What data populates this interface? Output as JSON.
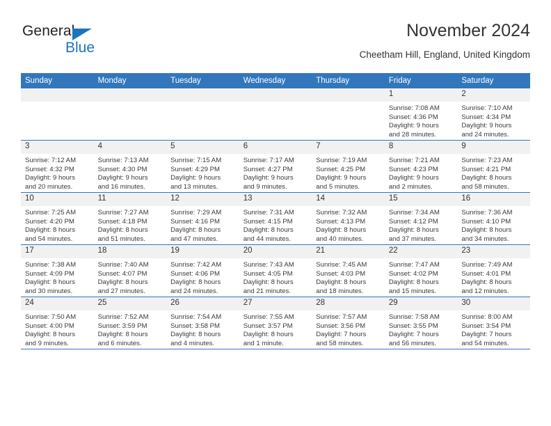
{
  "brand": {
    "name_top": "General",
    "name_bottom": "Blue",
    "triangle_color": "#1b75bc"
  },
  "header": {
    "title": "November 2024",
    "subtitle": "Cheetham Hill, England, United Kingdom"
  },
  "theme": {
    "header_blue": "#3277bc",
    "daynum_gray": "#f1f1f1",
    "text": "#333333"
  },
  "weekdays": [
    "Sunday",
    "Monday",
    "Tuesday",
    "Wednesday",
    "Thursday",
    "Friday",
    "Saturday"
  ],
  "weeks": [
    [
      {
        "day": "",
        "sunrise": "",
        "sunset": "",
        "daylight_line1": "",
        "daylight_line2": ""
      },
      {
        "day": "",
        "sunrise": "",
        "sunset": "",
        "daylight_line1": "",
        "daylight_line2": ""
      },
      {
        "day": "",
        "sunrise": "",
        "sunset": "",
        "daylight_line1": "",
        "daylight_line2": ""
      },
      {
        "day": "",
        "sunrise": "",
        "sunset": "",
        "daylight_line1": "",
        "daylight_line2": ""
      },
      {
        "day": "",
        "sunrise": "",
        "sunset": "",
        "daylight_line1": "",
        "daylight_line2": ""
      },
      {
        "day": "1",
        "sunrise": "Sunrise: 7:08 AM",
        "sunset": "Sunset: 4:36 PM",
        "daylight_line1": "Daylight: 9 hours",
        "daylight_line2": "and 28 minutes."
      },
      {
        "day": "2",
        "sunrise": "Sunrise: 7:10 AM",
        "sunset": "Sunset: 4:34 PM",
        "daylight_line1": "Daylight: 9 hours",
        "daylight_line2": "and 24 minutes."
      }
    ],
    [
      {
        "day": "3",
        "sunrise": "Sunrise: 7:12 AM",
        "sunset": "Sunset: 4:32 PM",
        "daylight_line1": "Daylight: 9 hours",
        "daylight_line2": "and 20 minutes."
      },
      {
        "day": "4",
        "sunrise": "Sunrise: 7:13 AM",
        "sunset": "Sunset: 4:30 PM",
        "daylight_line1": "Daylight: 9 hours",
        "daylight_line2": "and 16 minutes."
      },
      {
        "day": "5",
        "sunrise": "Sunrise: 7:15 AM",
        "sunset": "Sunset: 4:29 PM",
        "daylight_line1": "Daylight: 9 hours",
        "daylight_line2": "and 13 minutes."
      },
      {
        "day": "6",
        "sunrise": "Sunrise: 7:17 AM",
        "sunset": "Sunset: 4:27 PM",
        "daylight_line1": "Daylight: 9 hours",
        "daylight_line2": "and 9 minutes."
      },
      {
        "day": "7",
        "sunrise": "Sunrise: 7:19 AM",
        "sunset": "Sunset: 4:25 PM",
        "daylight_line1": "Daylight: 9 hours",
        "daylight_line2": "and 5 minutes."
      },
      {
        "day": "8",
        "sunrise": "Sunrise: 7:21 AM",
        "sunset": "Sunset: 4:23 PM",
        "daylight_line1": "Daylight: 9 hours",
        "daylight_line2": "and 2 minutes."
      },
      {
        "day": "9",
        "sunrise": "Sunrise: 7:23 AM",
        "sunset": "Sunset: 4:21 PM",
        "daylight_line1": "Daylight: 8 hours",
        "daylight_line2": "and 58 minutes."
      }
    ],
    [
      {
        "day": "10",
        "sunrise": "Sunrise: 7:25 AM",
        "sunset": "Sunset: 4:20 PM",
        "daylight_line1": "Daylight: 8 hours",
        "daylight_line2": "and 54 minutes."
      },
      {
        "day": "11",
        "sunrise": "Sunrise: 7:27 AM",
        "sunset": "Sunset: 4:18 PM",
        "daylight_line1": "Daylight: 8 hours",
        "daylight_line2": "and 51 minutes."
      },
      {
        "day": "12",
        "sunrise": "Sunrise: 7:29 AM",
        "sunset": "Sunset: 4:16 PM",
        "daylight_line1": "Daylight: 8 hours",
        "daylight_line2": "and 47 minutes."
      },
      {
        "day": "13",
        "sunrise": "Sunrise: 7:31 AM",
        "sunset": "Sunset: 4:15 PM",
        "daylight_line1": "Daylight: 8 hours",
        "daylight_line2": "and 44 minutes."
      },
      {
        "day": "14",
        "sunrise": "Sunrise: 7:32 AM",
        "sunset": "Sunset: 4:13 PM",
        "daylight_line1": "Daylight: 8 hours",
        "daylight_line2": "and 40 minutes."
      },
      {
        "day": "15",
        "sunrise": "Sunrise: 7:34 AM",
        "sunset": "Sunset: 4:12 PM",
        "daylight_line1": "Daylight: 8 hours",
        "daylight_line2": "and 37 minutes."
      },
      {
        "day": "16",
        "sunrise": "Sunrise: 7:36 AM",
        "sunset": "Sunset: 4:10 PM",
        "daylight_line1": "Daylight: 8 hours",
        "daylight_line2": "and 34 minutes."
      }
    ],
    [
      {
        "day": "17",
        "sunrise": "Sunrise: 7:38 AM",
        "sunset": "Sunset: 4:09 PM",
        "daylight_line1": "Daylight: 8 hours",
        "daylight_line2": "and 30 minutes."
      },
      {
        "day": "18",
        "sunrise": "Sunrise: 7:40 AM",
        "sunset": "Sunset: 4:07 PM",
        "daylight_line1": "Daylight: 8 hours",
        "daylight_line2": "and 27 minutes."
      },
      {
        "day": "19",
        "sunrise": "Sunrise: 7:42 AM",
        "sunset": "Sunset: 4:06 PM",
        "daylight_line1": "Daylight: 8 hours",
        "daylight_line2": "and 24 minutes."
      },
      {
        "day": "20",
        "sunrise": "Sunrise: 7:43 AM",
        "sunset": "Sunset: 4:05 PM",
        "daylight_line1": "Daylight: 8 hours",
        "daylight_line2": "and 21 minutes."
      },
      {
        "day": "21",
        "sunrise": "Sunrise: 7:45 AM",
        "sunset": "Sunset: 4:03 PM",
        "daylight_line1": "Daylight: 8 hours",
        "daylight_line2": "and 18 minutes."
      },
      {
        "day": "22",
        "sunrise": "Sunrise: 7:47 AM",
        "sunset": "Sunset: 4:02 PM",
        "daylight_line1": "Daylight: 8 hours",
        "daylight_line2": "and 15 minutes."
      },
      {
        "day": "23",
        "sunrise": "Sunrise: 7:49 AM",
        "sunset": "Sunset: 4:01 PM",
        "daylight_line1": "Daylight: 8 hours",
        "daylight_line2": "and 12 minutes."
      }
    ],
    [
      {
        "day": "24",
        "sunrise": "Sunrise: 7:50 AM",
        "sunset": "Sunset: 4:00 PM",
        "daylight_line1": "Daylight: 8 hours",
        "daylight_line2": "and 9 minutes."
      },
      {
        "day": "25",
        "sunrise": "Sunrise: 7:52 AM",
        "sunset": "Sunset: 3:59 PM",
        "daylight_line1": "Daylight: 8 hours",
        "daylight_line2": "and 6 minutes."
      },
      {
        "day": "26",
        "sunrise": "Sunrise: 7:54 AM",
        "sunset": "Sunset: 3:58 PM",
        "daylight_line1": "Daylight: 8 hours",
        "daylight_line2": "and 4 minutes."
      },
      {
        "day": "27",
        "sunrise": "Sunrise: 7:55 AM",
        "sunset": "Sunset: 3:57 PM",
        "daylight_line1": "Daylight: 8 hours",
        "daylight_line2": "and 1 minute."
      },
      {
        "day": "28",
        "sunrise": "Sunrise: 7:57 AM",
        "sunset": "Sunset: 3:56 PM",
        "daylight_line1": "Daylight: 7 hours",
        "daylight_line2": "and 58 minutes."
      },
      {
        "day": "29",
        "sunrise": "Sunrise: 7:58 AM",
        "sunset": "Sunset: 3:55 PM",
        "daylight_line1": "Daylight: 7 hours",
        "daylight_line2": "and 56 minutes."
      },
      {
        "day": "30",
        "sunrise": "Sunrise: 8:00 AM",
        "sunset": "Sunset: 3:54 PM",
        "daylight_line1": "Daylight: 7 hours",
        "daylight_line2": "and 54 minutes."
      }
    ]
  ]
}
